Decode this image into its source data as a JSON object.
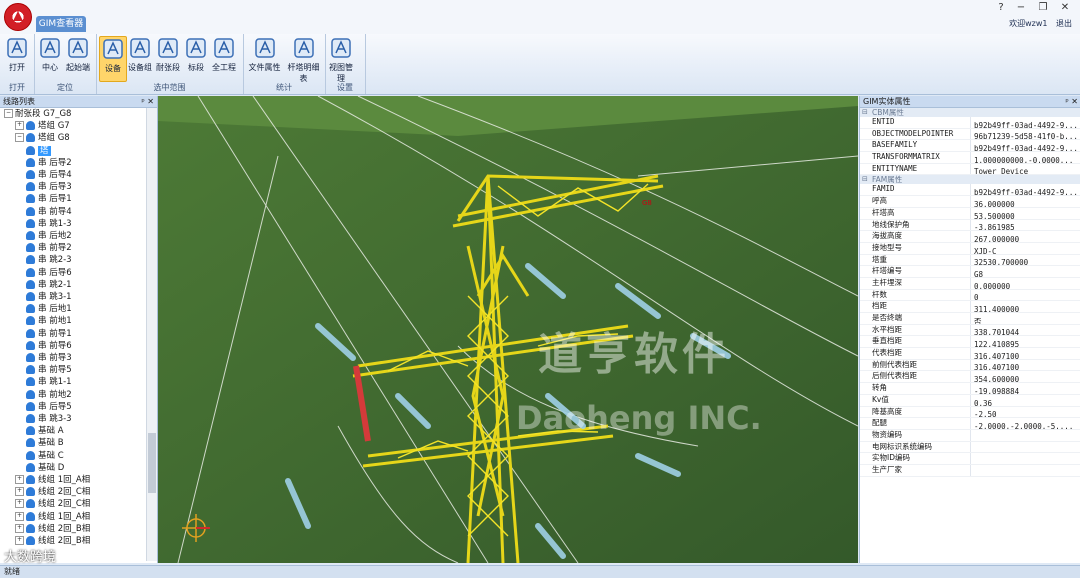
{
  "window": {
    "tab_label": "GIM查看器",
    "controls": [
      "?",
      "−",
      "❐",
      "✕"
    ],
    "welcome": "欢迎wzw1",
    "logout": "退出"
  },
  "ribbon": {
    "groups": [
      {
        "label": "打开",
        "buttons": [
          {
            "label": "打开",
            "icon": "gim-open-icon"
          }
        ]
      },
      {
        "label": "定位",
        "buttons": [
          {
            "label": "中心",
            "icon": "center-locate-icon"
          },
          {
            "label": "起始端",
            "icon": "start-point-icon"
          }
        ]
      },
      {
        "label": "选中范围",
        "buttons": [
          {
            "label": "设备",
            "icon": "device-tower-icon",
            "active": true
          },
          {
            "label": "设备组",
            "icon": "device-group-icon"
          },
          {
            "label": "耐张段",
            "icon": "tension-section-icon"
          },
          {
            "label": "标段",
            "icon": "bid-section-icon"
          },
          {
            "label": "全工程",
            "icon": "whole-project-icon"
          }
        ]
      },
      {
        "label": "统计",
        "buttons": [
          {
            "label": "文件属性",
            "icon": "file-properties-icon"
          },
          {
            "label": "杆塔明细表",
            "icon": "tower-detail-table-icon"
          }
        ]
      },
      {
        "label": "设置",
        "buttons": [
          {
            "label": "视图管理",
            "icon": "view-manager-icon"
          }
        ]
      }
    ]
  },
  "left_panel": {
    "title": "线路列表",
    "pin": "ᵖ ✕",
    "tree": [
      {
        "level": 0,
        "exp": "⊟",
        "label": "耐张段  G7_G8",
        "icon": false
      },
      {
        "level": 1,
        "exp": "⊞",
        "label": "塔组 G7",
        "icon": true
      },
      {
        "level": 1,
        "exp": "⊟",
        "label": "塔组 G8",
        "icon": true
      },
      {
        "level": 2,
        "exp": "",
        "label": "塔",
        "icon": true,
        "selected": true
      },
      {
        "level": 2,
        "exp": "",
        "label": "串 后导2",
        "icon": true
      },
      {
        "level": 2,
        "exp": "",
        "label": "串 后导4",
        "icon": true
      },
      {
        "level": 2,
        "exp": "",
        "label": "串 后导3",
        "icon": true
      },
      {
        "level": 2,
        "exp": "",
        "label": "串 后导1",
        "icon": true
      },
      {
        "level": 2,
        "exp": "",
        "label": "串 前导4",
        "icon": true
      },
      {
        "level": 2,
        "exp": "",
        "label": "串 跳1-3",
        "icon": true
      },
      {
        "level": 2,
        "exp": "",
        "label": "串 后地2",
        "icon": true
      },
      {
        "level": 2,
        "exp": "",
        "label": "串 前导2",
        "icon": true
      },
      {
        "level": 2,
        "exp": "",
        "label": "串 跳2-3",
        "icon": true
      },
      {
        "level": 2,
        "exp": "",
        "label": "串 后导6",
        "icon": true
      },
      {
        "level": 2,
        "exp": "",
        "label": "串 跳2-1",
        "icon": true
      },
      {
        "level": 2,
        "exp": "",
        "label": "串 跳3-1",
        "icon": true
      },
      {
        "level": 2,
        "exp": "",
        "label": "串 后地1",
        "icon": true
      },
      {
        "level": 2,
        "exp": "",
        "label": "串 前地1",
        "icon": true
      },
      {
        "level": 2,
        "exp": "",
        "label": "串 前导1",
        "icon": true
      },
      {
        "level": 2,
        "exp": "",
        "label": "串 前导6",
        "icon": true
      },
      {
        "level": 2,
        "exp": "",
        "label": "串 前导3",
        "icon": true
      },
      {
        "level": 2,
        "exp": "",
        "label": "串 前导5",
        "icon": true
      },
      {
        "level": 2,
        "exp": "",
        "label": "串 跳1-1",
        "icon": true
      },
      {
        "level": 2,
        "exp": "",
        "label": "串 前地2",
        "icon": true
      },
      {
        "level": 2,
        "exp": "",
        "label": "串 后导5",
        "icon": true
      },
      {
        "level": 2,
        "exp": "",
        "label": "串 跳3-3",
        "icon": true
      },
      {
        "level": 2,
        "exp": "",
        "label": "基础 A",
        "icon": true
      },
      {
        "level": 2,
        "exp": "",
        "label": "基础 B",
        "icon": true
      },
      {
        "level": 2,
        "exp": "",
        "label": "基础 C",
        "icon": true
      },
      {
        "level": 2,
        "exp": "",
        "label": "基础 D",
        "icon": true
      },
      {
        "level": 1,
        "exp": "⊞",
        "label": "线组 1回_A相",
        "icon": true
      },
      {
        "level": 1,
        "exp": "⊞",
        "label": "线组 2回_C相",
        "icon": true
      },
      {
        "level": 1,
        "exp": "⊞",
        "label": "线组 2回_C相",
        "icon": true
      },
      {
        "level": 1,
        "exp": "⊞",
        "label": "线组 1回_A相",
        "icon": true
      },
      {
        "level": 1,
        "exp": "⊞",
        "label": "线组 2回_B相",
        "icon": true
      },
      {
        "level": 1,
        "exp": "⊞",
        "label": "线组 2回_B相",
        "icon": true
      }
    ]
  },
  "viewport": {
    "tower_label": "G8",
    "watermark_cn": "道亨软件",
    "watermark_en": "Daoheng INC."
  },
  "right_panel": {
    "title": "GIM实体属性",
    "pin": "ᵖ ✕",
    "sections": [
      {
        "title": "CBM属性",
        "rows": [
          {
            "k": "ENTID",
            "v": "b92b49ff-03ad-4492-9..."
          },
          {
            "k": "OBJECTMODELPOINTER",
            "v": "96b71239-5d58-41f0-b..."
          },
          {
            "k": "BASEFAMILY",
            "v": "b92b49ff-03ad-4492-9..."
          },
          {
            "k": "TRANSFORMMATRIX",
            "v": "1.000000000,-0.0000..."
          },
          {
            "k": "ENTITYNAME",
            "v": "Tower_Device"
          }
        ]
      },
      {
        "title": "FAM属性",
        "rows": [
          {
            "k": "FAMID",
            "v": "b92b49ff-03ad-4492-9..."
          },
          {
            "k": "呼高",
            "v": "36.000000",
            "cn": true
          },
          {
            "k": "杆塔高",
            "v": "53.500000",
            "cn": true
          },
          {
            "k": "地线保护角",
            "v": "-3.861985",
            "cn": true
          },
          {
            "k": "海拔高度",
            "v": "267.000000",
            "cn": true
          },
          {
            "k": "接地型号",
            "v": "XJD-C",
            "cn": true
          },
          {
            "k": "塔重",
            "v": "32530.700000",
            "cn": true
          },
          {
            "k": "杆塔编号",
            "v": "G8",
            "cn": true
          },
          {
            "k": "主杆埋深",
            "v": "0.000000",
            "cn": true
          },
          {
            "k": "杆数",
            "v": "0",
            "cn": true
          },
          {
            "k": "档距",
            "v": "311.400000",
            "cn": true
          },
          {
            "k": "是否终端",
            "v": "否",
            "cn": true
          },
          {
            "k": "水平档距",
            "v": "338.701044",
            "cn": true
          },
          {
            "k": "垂直档距",
            "v": "122.410895",
            "cn": true
          },
          {
            "k": "代表档距",
            "v": "316.407100",
            "cn": true
          },
          {
            "k": "前侧代表档距",
            "v": "316.407100",
            "cn": true
          },
          {
            "k": "后侧代表档距",
            "v": "354.600000",
            "cn": true
          },
          {
            "k": "转角",
            "v": "-19.098884",
            "cn": true
          },
          {
            "k": "Kv值",
            "v": "0.36",
            "cn": true
          },
          {
            "k": "降基高度",
            "v": "-2.50",
            "cn": true
          },
          {
            "k": "  配腿",
            "v": "-2.0000,-2.0000,-5....",
            "cn": true
          },
          {
            "k": "物资编码",
            "v": "",
            "cn": true
          },
          {
            "k": "电网标识系统编码",
            "v": "",
            "cn": true
          },
          {
            "k": "实物ID编码",
            "v": "",
            "cn": true
          },
          {
            "k": "生产厂家",
            "v": "",
            "cn": true
          }
        ]
      }
    ]
  },
  "status": {
    "text": "就绪"
  },
  "overlay": {
    "text": "大数跨境"
  }
}
